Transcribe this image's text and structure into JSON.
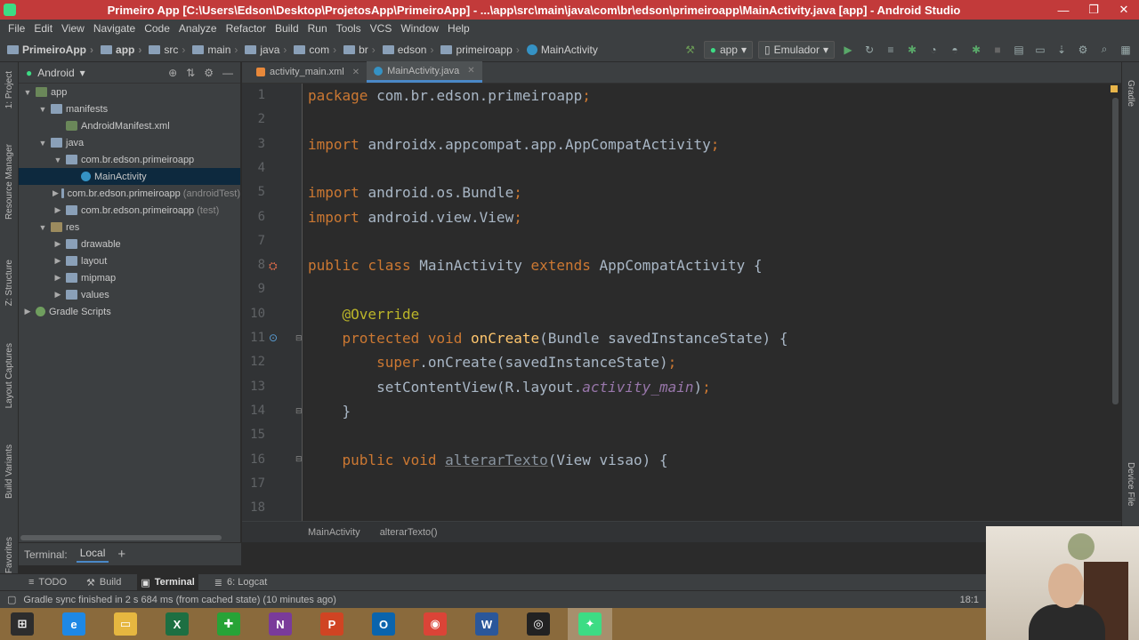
{
  "window": {
    "title": "Primeiro App [C:\\Users\\Edson\\Desktop\\ProjetosApp\\PrimeiroApp] - ...\\app\\src\\main\\java\\com\\br\\edson\\primeiroapp\\MainActivity.java [app] - Android Studio",
    "minimize": "—",
    "maximize": "❐",
    "close": "✕"
  },
  "menu": [
    "File",
    "Edit",
    "View",
    "Navigate",
    "Code",
    "Analyze",
    "Refactor",
    "Build",
    "Run",
    "Tools",
    "VCS",
    "Window",
    "Help"
  ],
  "breadcrumb": [
    "PrimeiroApp",
    "app",
    "src",
    "main",
    "java",
    "com",
    "br",
    "edson",
    "primeiroapp",
    "MainActivity"
  ],
  "toolbar": {
    "run_config": "app",
    "device": "Emulador"
  },
  "left_stripe": [
    "1: Project",
    "Resource Manager",
    "Z: Structure",
    "Layout Captures",
    "Build Variants",
    "Favorites"
  ],
  "right_stripe": [
    "Gradle",
    "Device File"
  ],
  "project_panel": {
    "view": "Android",
    "tree": [
      {
        "label": "app",
        "extra": "",
        "depth": 0,
        "arrow": "▼",
        "icon": "modfolder",
        "selected": false
      },
      {
        "label": "manifests",
        "extra": "",
        "depth": 1,
        "arrow": "▼",
        "icon": "folder",
        "selected": false
      },
      {
        "label": "AndroidManifest.xml",
        "extra": "",
        "depth": 2,
        "arrow": "",
        "icon": "xml",
        "selected": false
      },
      {
        "label": "java",
        "extra": "",
        "depth": 1,
        "arrow": "▼",
        "icon": "folder",
        "selected": false
      },
      {
        "label": "com.br.edson.primeiroapp",
        "extra": "",
        "depth": 2,
        "arrow": "▼",
        "icon": "folder",
        "selected": false
      },
      {
        "label": "MainActivity",
        "extra": "",
        "depth": 3,
        "arrow": "",
        "icon": "cls",
        "selected": true
      },
      {
        "label": "com.br.edson.primeiroapp",
        "extra": "(androidTest)",
        "depth": 2,
        "arrow": "▶",
        "icon": "folder",
        "selected": false
      },
      {
        "label": "com.br.edson.primeiroapp",
        "extra": "(test)",
        "depth": 2,
        "arrow": "▶",
        "icon": "folder",
        "selected": false
      },
      {
        "label": "res",
        "extra": "",
        "depth": 1,
        "arrow": "▼",
        "icon": "resfolder",
        "selected": false
      },
      {
        "label": "drawable",
        "extra": "",
        "depth": 2,
        "arrow": "▶",
        "icon": "folder",
        "selected": false
      },
      {
        "label": "layout",
        "extra": "",
        "depth": 2,
        "arrow": "▶",
        "icon": "folder",
        "selected": false
      },
      {
        "label": "mipmap",
        "extra": "",
        "depth": 2,
        "arrow": "▶",
        "icon": "folder",
        "selected": false
      },
      {
        "label": "values",
        "extra": "",
        "depth": 2,
        "arrow": "▶",
        "icon": "folder",
        "selected": false
      },
      {
        "label": "Gradle Scripts",
        "extra": "",
        "depth": 0,
        "arrow": "▶",
        "icon": "gradle",
        "selected": false
      }
    ]
  },
  "terminal": {
    "label": "Terminal:",
    "tab": "Local",
    "add": "+"
  },
  "editor_tabs": [
    {
      "label": "activity_main.xml",
      "active": false,
      "icon": "xml"
    },
    {
      "label": "MainActivity.java",
      "active": true,
      "icon": "cls"
    }
  ],
  "code_lines": [
    {
      "n": "1",
      "tokens": [
        [
          "kw",
          "package "
        ],
        [
          "id",
          "com.br.edson.primeiroapp"
        ],
        [
          "pu",
          ";"
        ]
      ]
    },
    {
      "n": "2",
      "tokens": []
    },
    {
      "n": "3",
      "tokens": [
        [
          "kw",
          "import "
        ],
        [
          "id",
          "androidx.appcompat.app.AppCompatActivity"
        ],
        [
          "pu",
          ";"
        ]
      ]
    },
    {
      "n": "4",
      "tokens": []
    },
    {
      "n": "5",
      "tokens": [
        [
          "kw",
          "import "
        ],
        [
          "id",
          "android.os.Bundle"
        ],
        [
          "pu",
          ";"
        ]
      ]
    },
    {
      "n": "6",
      "tokens": [
        [
          "kw",
          "import "
        ],
        [
          "id",
          "android.view.View"
        ],
        [
          "pu",
          ";"
        ]
      ]
    },
    {
      "n": "7",
      "tokens": []
    },
    {
      "n": "8",
      "tokens": [
        [
          "kw",
          "public class "
        ],
        [
          "id",
          "MainActivity "
        ],
        [
          "kw",
          "extends "
        ],
        [
          "id",
          "AppCompatActivity {"
        ]
      ]
    },
    {
      "n": "9",
      "tokens": []
    },
    {
      "n": "10",
      "tokens": [
        [
          "id",
          "    "
        ],
        [
          "an",
          "@Override"
        ]
      ]
    },
    {
      "n": "11",
      "tokens": [
        [
          "id",
          "    "
        ],
        [
          "kw",
          "protected void "
        ],
        [
          "fn",
          "onCreate"
        ],
        [
          "id",
          "(Bundle savedInstanceState) {"
        ]
      ]
    },
    {
      "n": "12",
      "tokens": [
        [
          "id",
          "        "
        ],
        [
          "kw",
          "super"
        ],
        [
          "id",
          ".onCreate(savedInstanceState)"
        ],
        [
          "pu",
          ";"
        ]
      ]
    },
    {
      "n": "13",
      "tokens": [
        [
          "id",
          "        setContentView(R.layout."
        ],
        [
          "it",
          "activity_main"
        ],
        [
          "id",
          ")"
        ],
        [
          "pu",
          ";"
        ]
      ]
    },
    {
      "n": "14",
      "tokens": [
        [
          "id",
          "    }"
        ]
      ]
    },
    {
      "n": "15",
      "tokens": []
    },
    {
      "n": "16",
      "tokens": [
        [
          "id",
          "    "
        ],
        [
          "kw",
          "public void "
        ],
        [
          "un",
          "alterarTexto"
        ],
        [
          "id",
          "(View visao) {"
        ]
      ]
    },
    {
      "n": "17",
      "tokens": []
    },
    {
      "n": "18",
      "tokens": []
    }
  ],
  "editor_breadcrumb": [
    "MainActivity",
    "alterarTexto()"
  ],
  "bottom_tabs": [
    {
      "label": "TODO",
      "icon": "≡",
      "active": false
    },
    {
      "label": "Build",
      "icon": "⚒",
      "active": false
    },
    {
      "label": "Terminal",
      "icon": "▣",
      "active": true
    },
    {
      "label": "6: Logcat",
      "icon": "≣",
      "active": false
    }
  ],
  "status": {
    "message": "Gradle sync finished in 2 s 684 ms (from cached state) (10 minutes ago)",
    "position": "18:1"
  },
  "taskbar": [
    {
      "name": "windows-start",
      "glyph": "⊞",
      "color": "#2d2d2d"
    },
    {
      "name": "internet-explorer",
      "glyph": "e",
      "color": "#1e88e5"
    },
    {
      "name": "file-explorer",
      "glyph": "▭",
      "color": "#e6b740"
    },
    {
      "name": "excel",
      "glyph": "X",
      "color": "#1d6f42"
    },
    {
      "name": "project",
      "glyph": "✚",
      "color": "#27a337"
    },
    {
      "name": "onenote",
      "glyph": "N",
      "color": "#7a3b9a"
    },
    {
      "name": "powerpoint",
      "glyph": "P",
      "color": "#d04423"
    },
    {
      "name": "outlook",
      "glyph": "O",
      "color": "#0a64ad"
    },
    {
      "name": "chrome",
      "glyph": "◉",
      "color": "#db4437"
    },
    {
      "name": "word",
      "glyph": "W",
      "color": "#2b579a"
    },
    {
      "name": "obs",
      "glyph": "◎",
      "color": "#222222"
    },
    {
      "name": "android-studio",
      "glyph": "✦",
      "color": "#3ddc84"
    }
  ]
}
